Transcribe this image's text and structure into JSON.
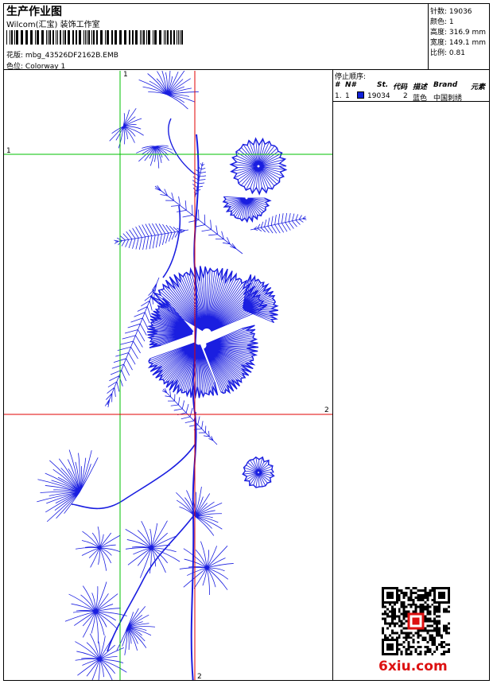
{
  "header": {
    "title": "生产作业图",
    "company": "Wilcom(汇宝) 装饰工作室",
    "design_label": "花版:",
    "design_value": "mbg_43526DF2162B.EMB",
    "colorway_label": "色位:",
    "colorway_value": "Colorway 1"
  },
  "stats": {
    "stitches": "针数: 19036",
    "colors": "颜色: 1",
    "height": "高度: 316.9 mm",
    "width": "宽度: 149.1 mm",
    "scale": "比例: 0.81"
  },
  "stop_sequence": {
    "label": "停止顺序:",
    "headers": [
      "#",
      "N#",
      "St.",
      "代码",
      "描述",
      "Brand",
      "元素"
    ],
    "row": {
      "idx": "1.",
      "n": "1",
      "stitches": "19034",
      "code": "2",
      "desc": "蓝色",
      "brand": "中国刺绣"
    },
    "swatch_color": "#1020d8"
  },
  "guides": {
    "green_v": "1",
    "green_h": "1",
    "red_v": "2",
    "red_h": "2",
    "green_color": "#00c000",
    "red_color": "#e00000"
  },
  "embroidery_color": "#1a1ee0",
  "watermark": "6xiu.com"
}
